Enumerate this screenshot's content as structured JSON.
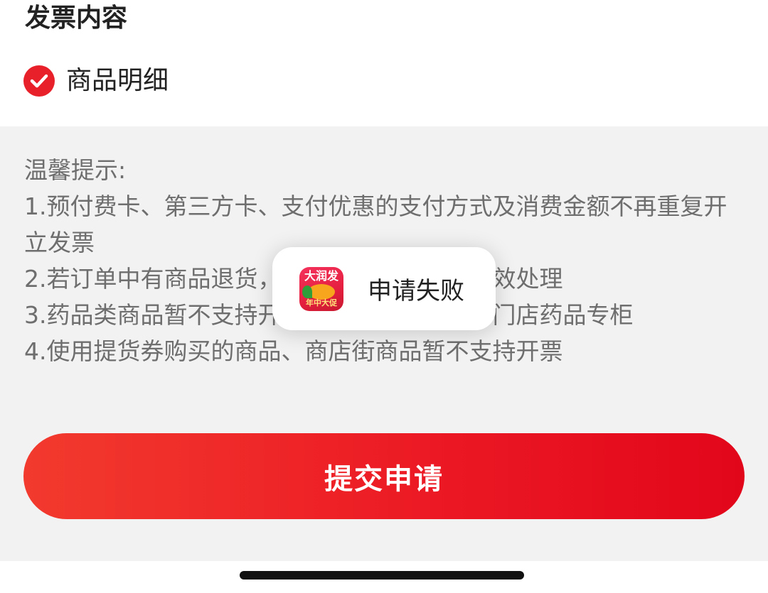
{
  "invoice_content": {
    "title": "发票内容",
    "option_label": "商品明细",
    "option_checked": true
  },
  "tips": {
    "heading": "温馨提示:",
    "lines": [
      "1.预付费卡、第三方卡、支付优惠的支付方式及消费金额不再重复开立发票",
      "2.若订单中有商品退货，则原已开发票将作失效处理",
      "3.药品类商品暂不支持开票，如需开票请联系门店药品专柜",
      "4.使用提货券购买的商品、商店街商品暂不支持开票"
    ]
  },
  "submit": {
    "label": "提交申请"
  },
  "toast": {
    "message": "申请失败",
    "app_icon_top": "大润发",
    "app_icon_bottom": "年中大促"
  },
  "colors": {
    "accent": "#e8202a",
    "background": "#f2f2f2",
    "card": "#ffffff"
  }
}
